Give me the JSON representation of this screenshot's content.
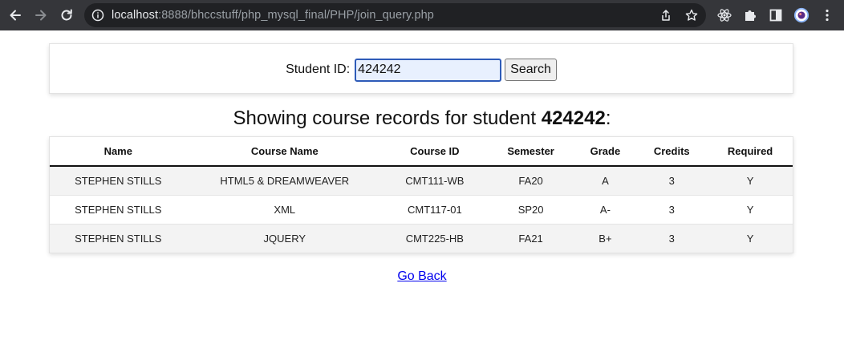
{
  "browser": {
    "url_host": "localhost",
    "url_path": ":8888/bhccstuff/php_mysql_final/PHP/join_query.php",
    "back_icon": "arrow-left-icon",
    "forward_icon": "arrow-right-icon",
    "reload_icon": "reload-icon",
    "info_icon": "info-icon",
    "share_icon": "share-icon",
    "bookmark_icon": "star-icon",
    "extensions": [
      "react-icon",
      "puzzle-icon",
      "sidebar-icon",
      "profile-icon",
      "more-icon"
    ]
  },
  "search": {
    "label": "Student ID:",
    "value": "424242",
    "button": "Search"
  },
  "heading": {
    "prefix": "Showing course records for student ",
    "student_id": "424242",
    "suffix": ":"
  },
  "table": {
    "columns": [
      "Name",
      "Course Name",
      "Course ID",
      "Semester",
      "Grade",
      "Credits",
      "Required"
    ],
    "rows": [
      [
        "STEPHEN STILLS",
        "HTML5 & DREAMWEAVER",
        "CMT111-WB",
        "FA20",
        "A",
        "3",
        "Y"
      ],
      [
        "STEPHEN STILLS",
        "XML",
        "CMT117-01",
        "SP20",
        "A-",
        "3",
        "Y"
      ],
      [
        "STEPHEN STILLS",
        "JQUERY",
        "CMT225-HB",
        "FA21",
        "B+",
        "3",
        "Y"
      ]
    ]
  },
  "footer": {
    "go_back": "Go Back"
  },
  "colors": {
    "chrome_bg": "#35363a",
    "omnibox_bg": "#202124",
    "input_border": "#2e5bb8",
    "input_bg": "#e8f0fe",
    "link": "#0000ee",
    "row_stripe": "#f3f3f3"
  }
}
